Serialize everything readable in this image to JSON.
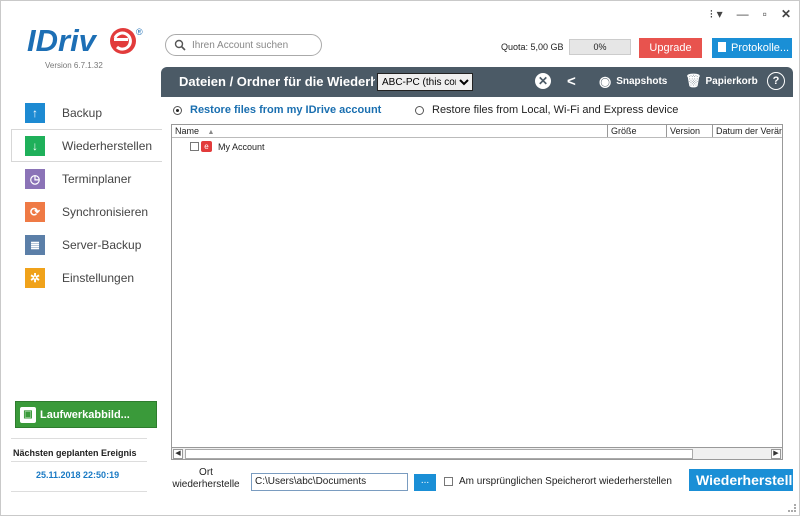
{
  "window": {
    "controls": {
      "menu": "⁝ ▾",
      "minimize": "—",
      "maximize": "▫",
      "close": "✕"
    }
  },
  "brand": {
    "logo_text": "IDrive",
    "version": "Version 6.7.1.32",
    "logo_color": "#1d6fb5",
    "accent": "#e23b3b"
  },
  "search": {
    "placeholder": "Ihren Account suchen"
  },
  "quota": {
    "label": "Quota: 5,00 GB",
    "used_text": "0%",
    "used_fraction": 0.0
  },
  "top_buttons": {
    "upgrade": "Upgrade",
    "protokolle": "Protokolle..."
  },
  "sidebar": {
    "items": [
      {
        "label": "Backup",
        "icon": "upload-arrow-icon"
      },
      {
        "label": "Wiederherstellen",
        "icon": "download-arrow-icon",
        "active": true
      },
      {
        "label": "Terminplaner",
        "icon": "clock-icon"
      },
      {
        "label": "Synchronisieren",
        "icon": "sync-icon"
      },
      {
        "label": "Server-Backup",
        "icon": "server-icon"
      },
      {
        "label": "Einstellungen",
        "icon": "gear-icon"
      }
    ],
    "drive_image_button": "Laufwerkabbild...",
    "next_event_label": "Nächsten geplanten Ereignis",
    "next_event_date": "25.11.2018 22:50:19"
  },
  "header": {
    "title": "Dateien / Ordner für die Wiederherstellung",
    "device_selected": "ABC-PC (this computer)",
    "snapshots": "Snapshots",
    "trash": "Papierkorb"
  },
  "restore_source": {
    "option_account": "Restore files from my IDrive account",
    "option_local": "Restore files from Local, Wi-Fi and Express device",
    "selected": "account"
  },
  "table": {
    "columns": [
      "Name",
      "Größe",
      "Version",
      "Datum der Veränderung"
    ],
    "rows": [
      {
        "name": "My Account"
      }
    ]
  },
  "bottom": {
    "location_label": "Ort wiederherstelle",
    "path": "C:\\Users\\abc\\Documents",
    "browse": "...",
    "original_location": "Am ursprünglichen Speicherort wiederherstellen",
    "restore_button": "Wiederherstellen"
  }
}
